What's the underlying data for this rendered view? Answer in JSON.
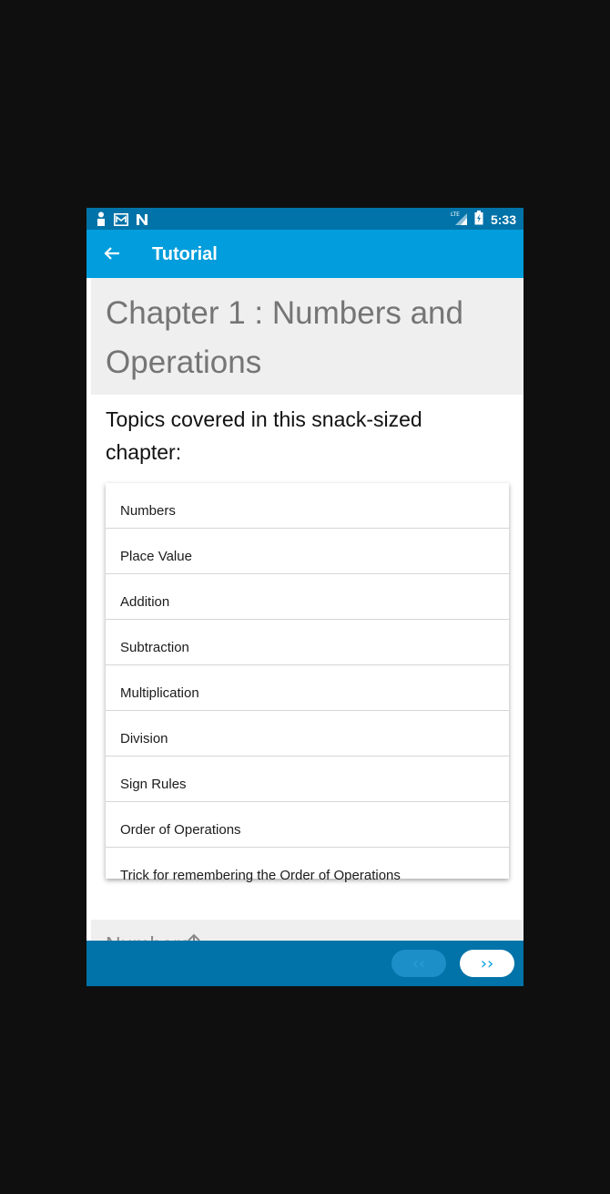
{
  "status_bar": {
    "time": "5:33",
    "network": "LTE",
    "left_icons": [
      "person-icon",
      "mail-icon",
      "n-icon"
    ],
    "right_icons": [
      "lte-signal-icon",
      "battery-charging-icon"
    ]
  },
  "app_bar": {
    "back_icon": "arrow-back-icon",
    "title": "Tutorial",
    "color": "#029ddc"
  },
  "chapter": {
    "title": "Chapter 1 : Numbers and Operations",
    "topics_heading": "Topics covered in this snack-sized chapter:",
    "topics": [
      "Numbers",
      "Place Value",
      "Addition",
      "Subtraction",
      "Multiplication",
      "Division",
      "Sign Rules",
      "Order of Operations",
      "Trick for remembering the Order of Operations"
    ]
  },
  "next_section": {
    "title": "Numbers",
    "icon": "arrow-up-icon"
  },
  "bottom_bar": {
    "prev_label": "‹‹",
    "next_label": "››",
    "color": "#0173a8"
  }
}
